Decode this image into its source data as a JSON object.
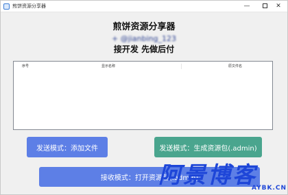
{
  "window": {
    "title": "煎饼资源分享器",
    "minimize_glyph": "—",
    "close_glyph": "✕"
  },
  "header": {
    "line1": "煎饼资源分享器",
    "line2": "+ @jianbing_123",
    "line3": "接开发 先做后付"
  },
  "list": {
    "columns": [
      "序号",
      "显示名称",
      "原文件名"
    ]
  },
  "buttons": {
    "send_file": "发送模式：添加文件",
    "send_pack": "发送模式：生成资源包(.admin)",
    "receive": "接收模式：打开资源包(.admin)"
  },
  "watermark": {
    "big": "阿景博客",
    "small": "AYBK.CN"
  },
  "colors": {
    "primary": "#5d7fe6",
    "green": "#4aa58e",
    "watermark": "#1e46d8"
  }
}
